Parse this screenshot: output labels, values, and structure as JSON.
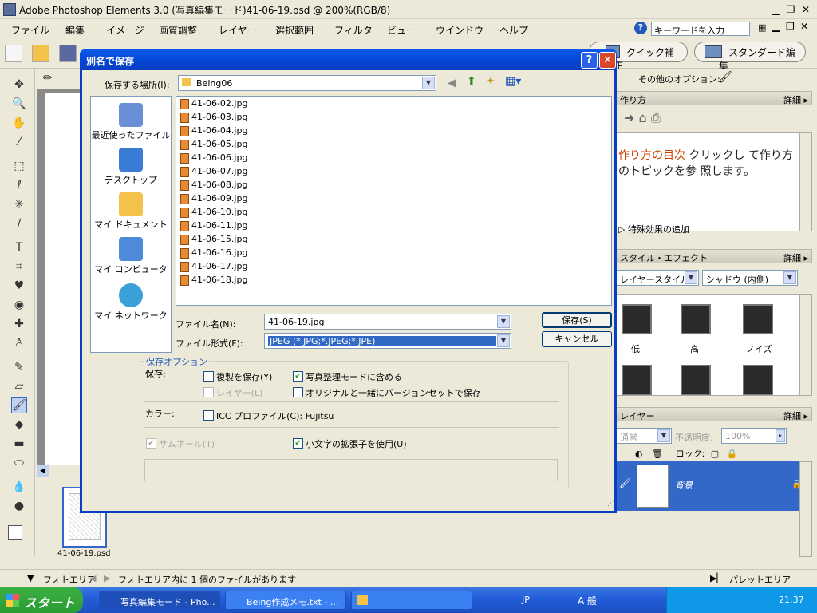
{
  "app": {
    "title": "Adobe Photoshop Elements 3.0 (写真編集モード)41-06-19.psd @ 200%(RGB/8)"
  },
  "menu": [
    "ファイル",
    "編集",
    "イメージ",
    "画質調整",
    "レイヤー",
    "選択範囲",
    "フィルタ",
    "ビュー",
    "ウインドウ",
    "ヘルプ"
  ],
  "help_search": {
    "value": "キーワードを入力"
  },
  "toolbar": {
    "quick_fix": "クイック補正",
    "standard_edit": "スタンダード編集"
  },
  "options_bar": {
    "other_options": "その他のオプション:"
  },
  "panels": {
    "howto": {
      "title": "作り方",
      "more": "詳細",
      "text_highlight": "作り方の目次",
      "text_rest": " クリックし て作り方のトピックを参 照します。",
      "item": "特殊効果の追加"
    },
    "styles": {
      "title": "スタイル・エフェクト",
      "more": "詳細",
      "category": "レイヤースタイル",
      "subcategory": "シャドウ (内側)",
      "swatches": [
        "低",
        "高",
        "ノイズ"
      ]
    },
    "layers": {
      "title": "レイヤー",
      "more": "詳細",
      "blend": "通常",
      "opacity_label": "不透明度:",
      "opacity": "100%",
      "lock_label": "ロック:",
      "layer_name": "背景"
    }
  },
  "photobin": {
    "filename": "41-06-19.psd"
  },
  "status": {
    "photo_area": "フォトエリア",
    "message": "フォトエリア内に 1 個のファイルがあります",
    "palette_area": "パレットエリア"
  },
  "taskbar": {
    "start": "スタート",
    "tasks": [
      "写真編集モード - Pho...",
      "Being作成メモ.txt - ...",
      ""
    ],
    "lang": "JP",
    "ime": "A 般",
    "time": "21:37"
  },
  "dialog": {
    "title": "別名で保存",
    "save_in_label": "保存する場所(I):",
    "save_in_value": "Being06",
    "places": [
      "最近使ったファイル",
      "デスクトップ",
      "マイ ドキュメント",
      "マイ コンピュータ",
      "マイ ネットワーク"
    ],
    "files": [
      "41-06-02.jpg",
      "41-06-03.jpg",
      "41-06-04.jpg",
      "41-06-05.jpg",
      "41-06-06.jpg",
      "41-06-07.jpg",
      "41-06-08.jpg",
      "41-06-09.jpg",
      "41-06-10.jpg",
      "41-06-11.jpg",
      "41-06-15.jpg",
      "41-06-16.jpg",
      "41-06-17.jpg",
      "41-06-18.jpg"
    ],
    "filename_label": "ファイル名(N):",
    "filename_value": "41-06-19.jpg",
    "format_label": "ファイル形式(F):",
    "format_value": "JPEG (*.JPG;*.JPEG;*.JPE)",
    "save_button": "保存(S)",
    "cancel_button": "キャンセル",
    "options_title": "保存オプション",
    "save_label": "保存:",
    "opt_copy": "複製を保存(Y)",
    "opt_organizer": "写真整理モードに含める",
    "opt_layers": "レイヤー(L)",
    "opt_version": "オリジナルと一緒にバージョンセットで保存",
    "color_label": "カラー:",
    "opt_icc": "ICC プロファイル(C): Fujitsu",
    "opt_thumbnail": "サムネール(T)",
    "opt_lowercase": "小文字の拡張子を使用(U)"
  }
}
